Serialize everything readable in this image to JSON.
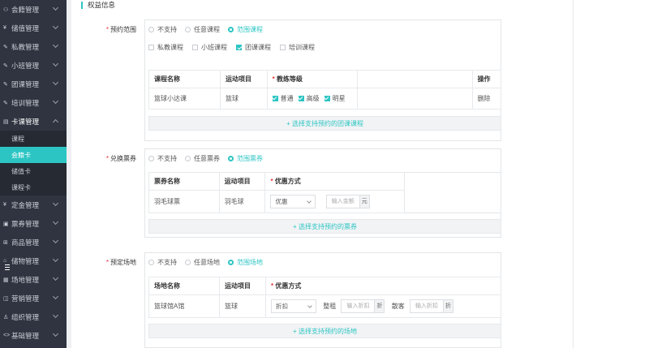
{
  "sidebar": {
    "items": [
      {
        "icon": "person-icon",
        "glyph": "⚇",
        "label": "会籍管理"
      },
      {
        "icon": "yen-icon",
        "glyph": "¥",
        "label": "储值管理"
      },
      {
        "icon": "edit-icon",
        "glyph": "✎",
        "label": "私教管理"
      },
      {
        "icon": "edit-icon",
        "glyph": "✎",
        "label": "小班管理"
      },
      {
        "icon": "edit-icon",
        "glyph": "✎",
        "label": "团课管理"
      },
      {
        "icon": "edit-icon",
        "glyph": "✎",
        "label": "培训管理"
      },
      {
        "icon": "card-icon",
        "glyph": "▤",
        "label": "卡课管理"
      }
    ],
    "sub_items": [
      "课程",
      "会籍卡",
      "储值卡",
      "课程卡"
    ],
    "items_bottom": [
      {
        "icon": "yen-icon",
        "glyph": "¥",
        "label": "定金管理"
      },
      {
        "icon": "ticket-icon",
        "glyph": "▣",
        "label": "票券管理"
      },
      {
        "icon": "cart-icon",
        "glyph": "⊞",
        "label": "商品管理"
      },
      {
        "icon": "locker-icon",
        "glyph": "⌂",
        "label": "储物管理"
      },
      {
        "icon": "venue-icon",
        "glyph": "▦",
        "label": "场地管理"
      },
      {
        "icon": "megaphone-icon",
        "glyph": "◫",
        "label": "营销管理"
      },
      {
        "icon": "org-icon",
        "glyph": "♙",
        "label": "组织管理"
      },
      {
        "icon": "code-icon",
        "glyph": "<>",
        "label": "基础管理"
      }
    ]
  },
  "section_title": "权益信息",
  "booking": {
    "label": "预约范围",
    "radios": [
      "不支持",
      "任意课程",
      "范围课程"
    ],
    "checks": [
      "私教课程",
      "小班课程",
      "团课课程",
      "培训课程"
    ],
    "headers": [
      "课程名称",
      "运动项目",
      "教练等级",
      "操作"
    ],
    "row": {
      "name": "篮球小达课",
      "sport": "篮球",
      "levels": [
        "普通",
        "高级",
        "明星"
      ],
      "action": "删除"
    },
    "add": "+ 选择支持预约的团课课程"
  },
  "voucher": {
    "label": "兑换票券",
    "radios": [
      "不支持",
      "任意票券",
      "范围票券"
    ],
    "headers": [
      "票券名称",
      "运动项目",
      "优惠方式"
    ],
    "row": {
      "name": "羽毛球票",
      "sport": "羽毛球",
      "method": "优惠",
      "placeholder": "输入金额",
      "unit": "元"
    },
    "add": "+ 选择支持预约的票券"
  },
  "venue": {
    "label": "预定场地",
    "radios": [
      "不支持",
      "任意场地",
      "范围场地"
    ],
    "headers": [
      "场地名称",
      "运动项目",
      "优惠方式"
    ],
    "row": {
      "name": "篮球馆A馆",
      "sport": "篮球",
      "method": "折扣",
      "whole_label": "整租",
      "whole_placeholder": "输入折扣",
      "whole_unit": "折",
      "single_label": "散客",
      "single_placeholder": "输入折扣",
      "single_unit": "折"
    },
    "add": "+ 选择支持预约的场地"
  },
  "colors": {
    "accent": "#2cc5c3",
    "sidebar": "#2f3440",
    "danger": "#e4393c"
  }
}
